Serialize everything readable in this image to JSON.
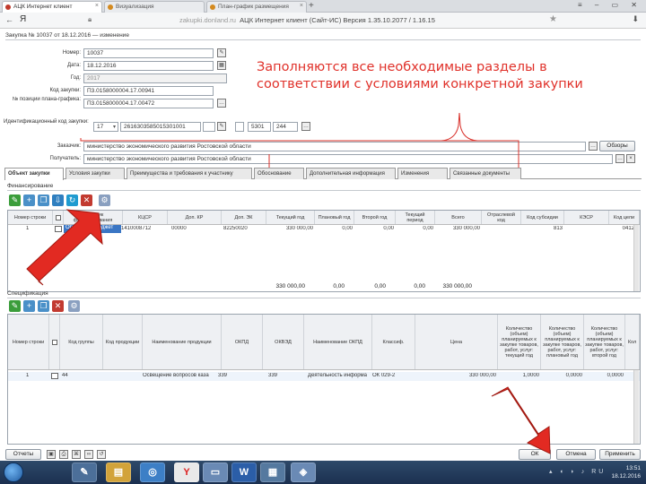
{
  "browser": {
    "tabs": [
      "АЦК Интернет клиент",
      "Визуализация",
      "План-график размещения"
    ],
    "url_domain": "zakupki.donland.ru",
    "url_title": "АЦК Интернет клиент (Сайт-ИС)  Версия 1.35.10.2077 / 1.16.15",
    "logo": "Я"
  },
  "app": {
    "title": "Закупка № 10037 от 18.12.2016 — изменение",
    "fields": {
      "number_label": "Номер:",
      "number_value": "10037",
      "date_label": "Дата:",
      "date_value": "18.12.2016",
      "year_label": "Год:",
      "year_value": "2017",
      "code_label": "Код закупки:",
      "code_value": "П3.0158000004.17.00941",
      "plan_label": "№ позиции плана-графика:",
      "plan_value": "П3.0158000004.17.00472",
      "ikz_label": "Идентификационный код закупки:",
      "ikz_year": "17",
      "ikz_value": "2616303585015301001",
      "ikz_part3": "5301",
      "ikz_part4": "244",
      "name_label": "Заказчик:",
      "name_value": "министерство экономического развития Ростовской области",
      "recipient_label": "Получатель:",
      "recipient_value": "министерство экономического развития Ростовской области",
      "overview_btn": "Обзоры"
    },
    "tabs": [
      "Объект закупки",
      "Условия закупки",
      "Преимущества и требования к участнику",
      "Обоснование",
      "Дополнительная информация",
      "Изменения",
      "Связанные документы"
    ],
    "section1": "Финансирование",
    "grid1": {
      "headers": [
        "Номер строки",
        "",
        "Источник финансирования",
        "КЦСР",
        "Доп. КР",
        "Доп. ЭК",
        "Текущий год",
        "Плановый год",
        "Второй год",
        "Текущий период",
        "Всего",
        "Отраслевой код",
        "Код субсидии",
        "КЭСР",
        "Код цели"
      ],
      "row": [
        "1",
        "Областной бюджет",
        "1410008712",
        "00000",
        "82250020",
        "330 000,00",
        "0,00",
        "0,00",
        "0,00",
        "330 000,00",
        "813",
        "0412"
      ],
      "total_current": "330 000,00",
      "total_plan": "0,00",
      "total_second": "0,00",
      "total_period": "0,00",
      "total_all": "330 000,00"
    },
    "section2": "Спецификация",
    "grid2": {
      "headers": [
        "Номер строки",
        "",
        "Код группы",
        "Код продукции",
        "Наименование продукции",
        "ОКПД",
        "ОКВЭД",
        "Наименование ОКПД",
        "Классиф.",
        "Цена",
        "Количество (объем) планируемых к закупке товаров, работ, услуг: текущий год",
        "Количество (объем) планируемых к закупке товаров, работ, услуг: плановый год",
        "Количество (объем) планируемых к закупке товаров, работ, услуг: второй год",
        "Кол"
      ],
      "row": [
        "1",
        "44",
        "Освещение вопросов каза",
        "339",
        "339",
        "Деятельность информа",
        "ОК 029-2",
        "330 000,00",
        "1,0000",
        "0,0000",
        "0,0000"
      ]
    },
    "buttons": {
      "left": "Отчеты",
      "ok": "ОК",
      "cancel": "Отмена",
      "apply": "Применить"
    }
  },
  "annotation": {
    "text": "Заполняются все необходимые разделы в соответствии с условиями конкретной закупки",
    "color": "#e0312a"
  },
  "taskbar": {
    "items": [
      "explorer",
      "browser",
      "yandex",
      "word",
      "app",
      "paint",
      "app2"
    ],
    "time": "13:51",
    "date": "18.12.2016",
    "lang": "RU"
  }
}
